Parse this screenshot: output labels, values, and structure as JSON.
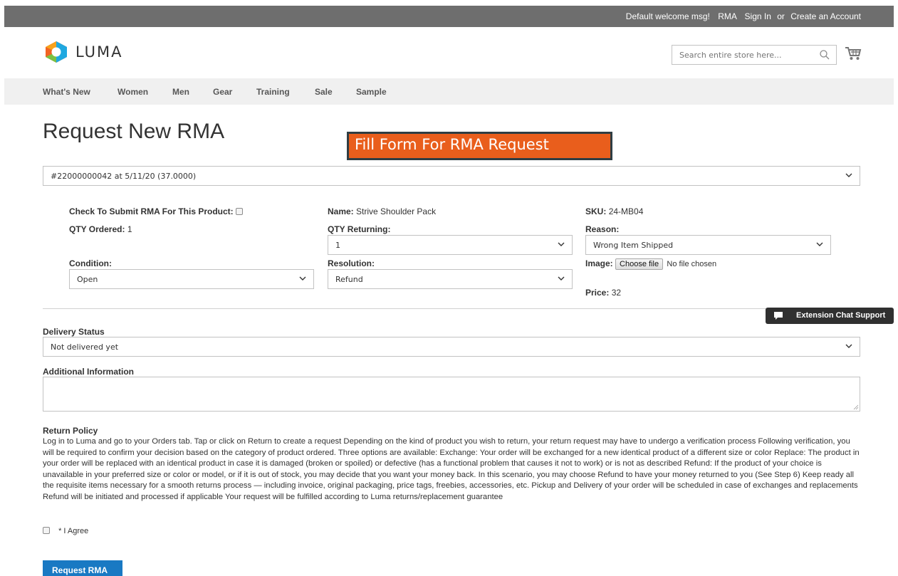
{
  "topbar": {
    "welcome": "Default welcome msg!",
    "rma": "RMA",
    "sign_in": "Sign In",
    "or": "or",
    "create_account": "Create an Account"
  },
  "header": {
    "logo_text": "LUMA",
    "search_placeholder": "Search entire store here..."
  },
  "nav": {
    "items": [
      "What's New",
      "Women",
      "Men",
      "Gear",
      "Training",
      "Sale",
      "Sample"
    ]
  },
  "page": {
    "title": "Request New RMA",
    "banner": "Fill Form For RMA Request"
  },
  "order_select": {
    "value": "#22000000042 at 5/11/20 (37.0000)"
  },
  "product": {
    "check_label": "Check To Submit RMA For This Product:",
    "name_label": "Name:",
    "name_value": "Strive Shoulder Pack",
    "sku_label": "SKU:",
    "sku_value": "24-MB04",
    "qty_ordered_label": "QTY Ordered:",
    "qty_ordered_value": "1",
    "qty_returning_label": "QTY Returning:",
    "qty_returning_value": "1",
    "reason_label": "Reason:",
    "reason_value": "Wrong Item Shipped",
    "condition_label": "Condition:",
    "condition_value": "Open",
    "resolution_label": "Resolution:",
    "resolution_value": "Refund",
    "image_label": "Image:",
    "choose_file": "Choose file",
    "no_file": "No file chosen",
    "price_label": "Price:",
    "price_value": "32"
  },
  "chat": {
    "label": "Extension Chat Support"
  },
  "delivery": {
    "label": "Delivery Status",
    "value": "Not delivered yet"
  },
  "additional": {
    "label": "Additional Information",
    "value": ""
  },
  "policy": {
    "heading": "Return Policy",
    "text": "Log in to Luma and go to your Orders tab. Tap or click on Return to create a request Depending on the kind of product you wish to return, your return request may have to undergo a verification process Following verification, you will be required to confirm your decision based on the category of product ordered. Three options are available: Exchange: Your order will be exchanged for a new identical product of a different size or color Replace: The product in your order will be replaced with an identical product in case it is damaged (broken or spoiled) or defective (has a functional problem that causes it not to work) or is not as described Refund: If the product of your choice is unavailable in your preferred size or color or model, or if it is out of stock, you may decide that you want your money back. In this scenario, you may choose Refund to have your money returned to you (See Step 6) Keep ready all the requisite items necessary for a smooth returns process — including invoice, original packaging, price tags, freebies, accessories, etc. Pickup and Delivery of your order will be scheduled in case of exchanges and replacements Refund will be initiated and processed if applicable Your request will be fulfilled according to Luma returns/replacement guarantee"
  },
  "agree": {
    "label": "* I Agree"
  },
  "submit": {
    "label": "Request RMA"
  },
  "colors": {
    "accent": "#1979c3",
    "banner": "#e95e1c",
    "topbar": "#6e6e6e"
  },
  "icons": [
    "luma-logo-icon",
    "search-icon",
    "cart-icon",
    "chevron-down-icon",
    "chat-bubble-icon",
    "resize-grip-icon"
  ]
}
